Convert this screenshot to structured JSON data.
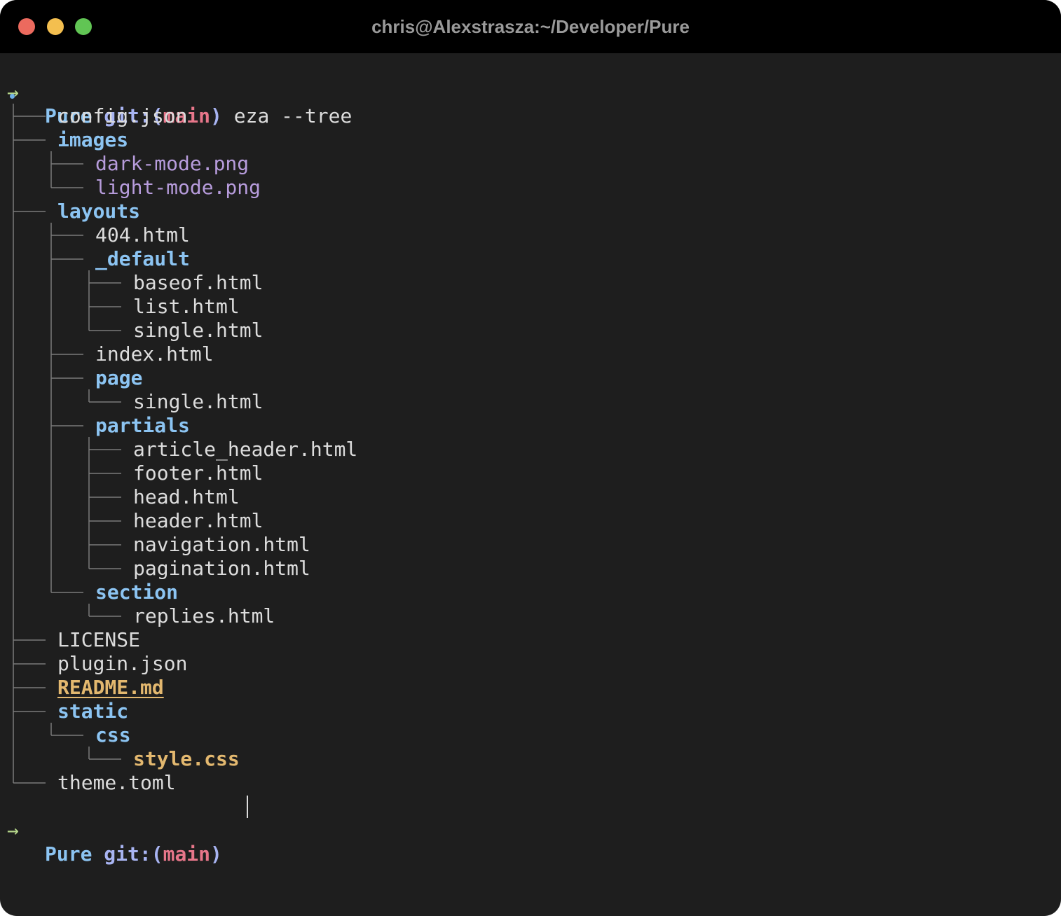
{
  "window": {
    "title": "chris@Alexstrasza:~/Developer/Pure",
    "traffic_lights": {
      "close_color": "#ec6a5e",
      "minimize_color": "#f4bf4f",
      "zoom_color": "#61c554"
    }
  },
  "prompt": {
    "arrow": "→",
    "dir": "Pure",
    "git_prefix": "git:(",
    "branch": "main",
    "git_suffix": ")",
    "command": "eza --tree"
  },
  "tree_root": ".",
  "tree": [
    {
      "name": "config.json",
      "type": "file"
    },
    {
      "name": "images",
      "type": "dir"
    },
    {
      "name": "dark-mode.png",
      "type": "image"
    },
    {
      "name": "light-mode.png",
      "type": "image"
    },
    {
      "name": "layouts",
      "type": "dir"
    },
    {
      "name": "404.html",
      "type": "file"
    },
    {
      "name": "_default",
      "type": "dir"
    },
    {
      "name": "baseof.html",
      "type": "file"
    },
    {
      "name": "list.html",
      "type": "file"
    },
    {
      "name": "single.html",
      "type": "file"
    },
    {
      "name": "index.html",
      "type": "file"
    },
    {
      "name": "page",
      "type": "dir"
    },
    {
      "name": "single.html",
      "type": "file"
    },
    {
      "name": "partials",
      "type": "dir"
    },
    {
      "name": "article_header.html",
      "type": "file"
    },
    {
      "name": "footer.html",
      "type": "file"
    },
    {
      "name": "head.html",
      "type": "file"
    },
    {
      "name": "header.html",
      "type": "file"
    },
    {
      "name": "navigation.html",
      "type": "file"
    },
    {
      "name": "pagination.html",
      "type": "file"
    },
    {
      "name": "section",
      "type": "dir"
    },
    {
      "name": "replies.html",
      "type": "file"
    },
    {
      "name": "LICENSE",
      "type": "file"
    },
    {
      "name": "plugin.json",
      "type": "file"
    },
    {
      "name": "README.md",
      "type": "readme"
    },
    {
      "name": "static",
      "type": "dir"
    },
    {
      "name": "css",
      "type": "dir"
    },
    {
      "name": "style.css",
      "type": "css"
    },
    {
      "name": "theme.toml",
      "type": "file"
    }
  ]
}
